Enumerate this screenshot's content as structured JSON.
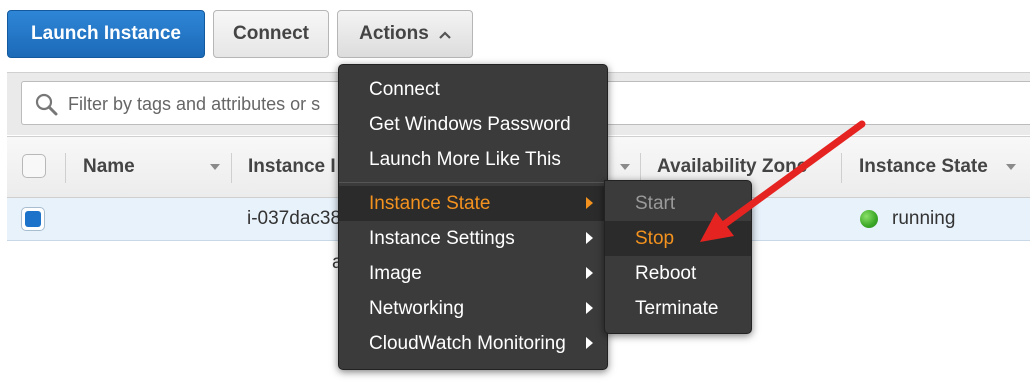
{
  "toolbar": {
    "launch_label": "Launch Instance",
    "connect_label": "Connect",
    "actions_label": "Actions"
  },
  "filter": {
    "placeholder": "Filter by tags and attributes or s"
  },
  "table": {
    "headers": {
      "name": "Name",
      "instance_id": "Instance I",
      "availability_zone": "Availability Zone",
      "instance_state": "Instance State"
    },
    "row": {
      "instance_id": "i-037dac38",
      "state": "running",
      "under_text": "a"
    }
  },
  "actions_menu": {
    "items": [
      {
        "label": "Connect"
      },
      {
        "label": "Get Windows Password"
      },
      {
        "label": "Launch More Like This"
      },
      {
        "label": "Instance State"
      },
      {
        "label": "Instance Settings"
      },
      {
        "label": "Image"
      },
      {
        "label": "Networking"
      },
      {
        "label": "CloudWatch Monitoring"
      }
    ]
  },
  "state_submenu": {
    "items": [
      {
        "label": "Start"
      },
      {
        "label": "Stop"
      },
      {
        "label": "Reboot"
      },
      {
        "label": "Terminate"
      }
    ]
  },
  "colors": {
    "primary_button": "#1b6ab8",
    "menu_bg": "#3b3b3b",
    "menu_highlight": "#f3921e",
    "running_status": "#3aa726",
    "annotation_arrow": "#e52421"
  },
  "icons": {
    "search": "search-icon",
    "actions_chevron": "chevron-up-icon",
    "submenu": "caret-right-icon",
    "running": "status-dot-icon"
  }
}
